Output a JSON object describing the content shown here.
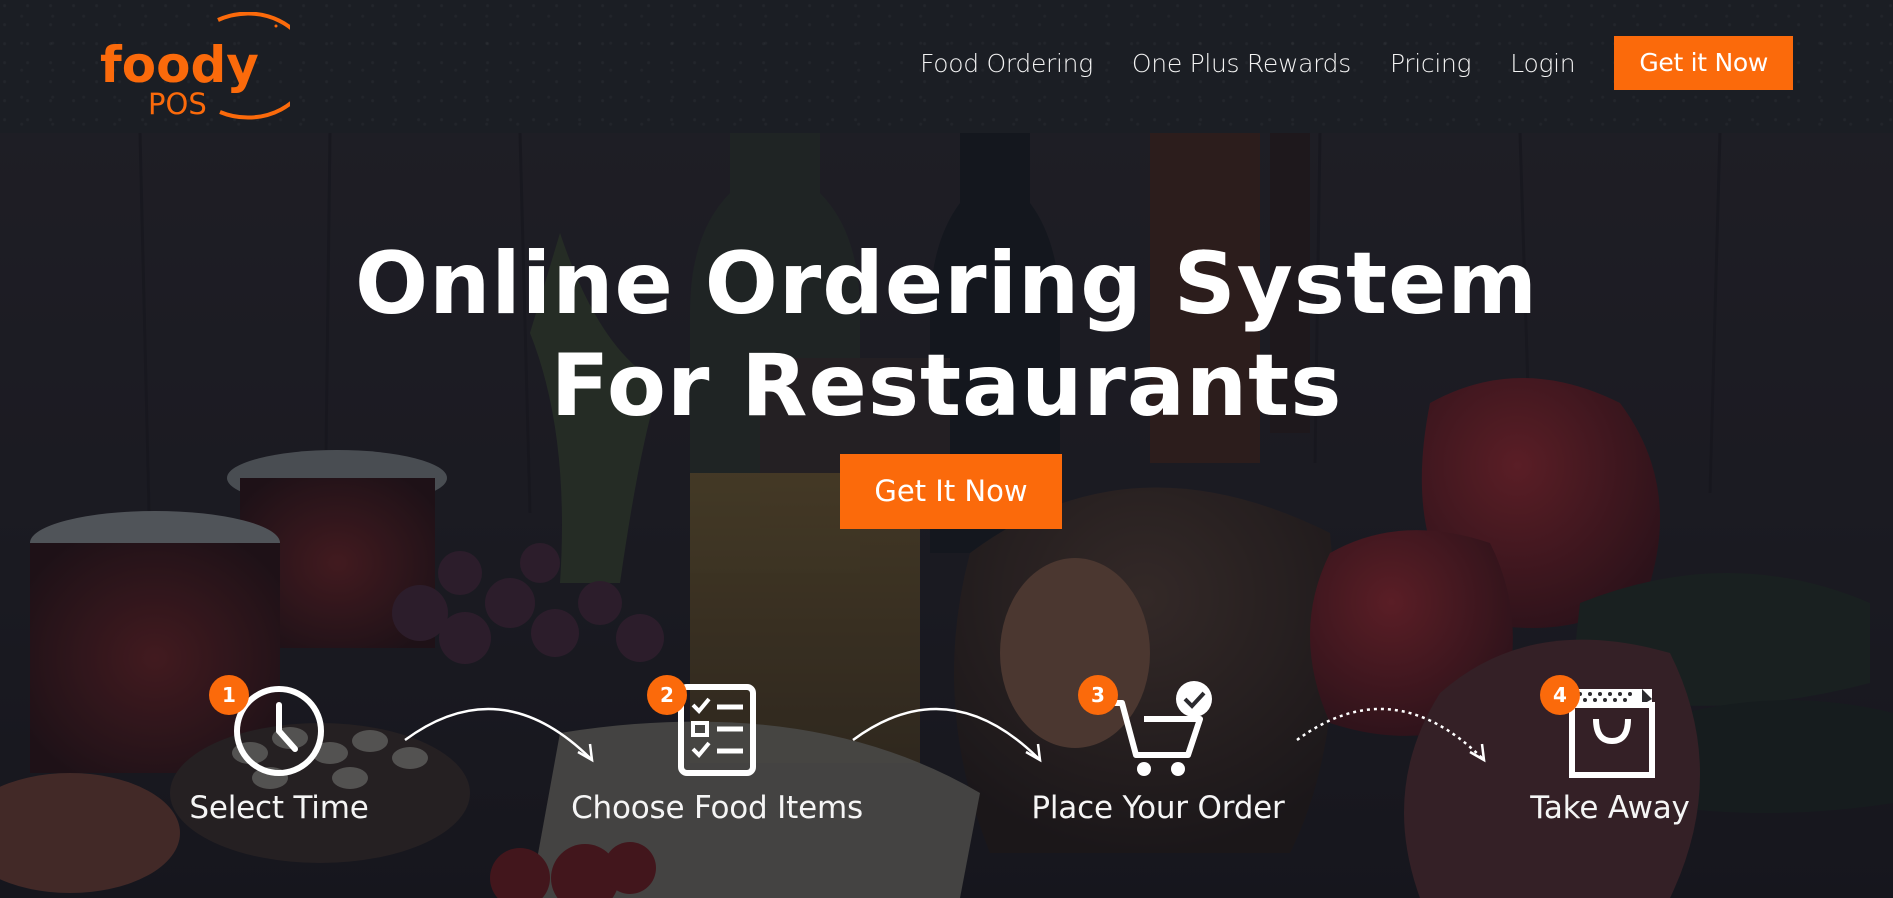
{
  "brand": {
    "logo_word": "foody",
    "logo_sub": "POS",
    "accent": "#fb6a0b"
  },
  "nav": {
    "items": [
      "Food Ordering",
      "One Plus Rewards",
      "Pricing",
      "Login"
    ],
    "cta": "Get it Now"
  },
  "hero": {
    "title_line1": "Online Ordering System",
    "title_line2": "For Restaurants",
    "cta": "Get It Now"
  },
  "steps": [
    {
      "number": "1",
      "label": "Select Time",
      "icon": "clock-icon"
    },
    {
      "number": "2",
      "label": "Choose Food Items",
      "icon": "checklist-icon"
    },
    {
      "number": "3",
      "label": "Place Your Order",
      "icon": "cart-check-icon"
    },
    {
      "number": "4",
      "label": "Take Away",
      "icon": "shopping-bag-icon"
    }
  ]
}
